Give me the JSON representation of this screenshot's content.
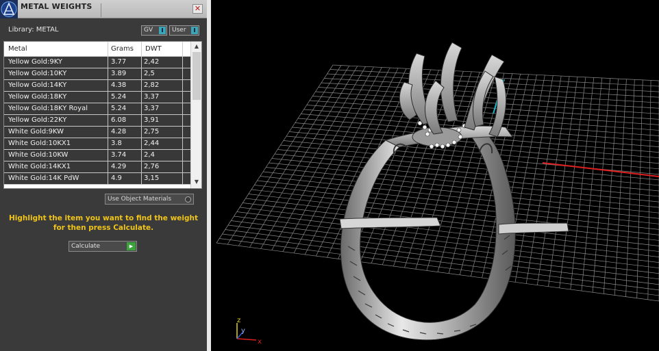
{
  "window": {
    "title": "METAL WEIGHTS",
    "close_glyph": "✕"
  },
  "library": {
    "label": "Library: METAL",
    "toggles": [
      {
        "label": "GV",
        "knob": "I"
      },
      {
        "label": "User",
        "knob": "I"
      }
    ]
  },
  "table": {
    "columns": [
      "Metal",
      "Grams",
      "DWT"
    ],
    "rows": [
      {
        "metal": "Yellow Gold:9KY",
        "grams": "3.77",
        "dwt": "2,42"
      },
      {
        "metal": "Yellow Gold:10KY",
        "grams": "3.89",
        "dwt": "2,5"
      },
      {
        "metal": "Yellow Gold:14KY",
        "grams": "4.38",
        "dwt": "2,82"
      },
      {
        "metal": "Yellow Gold:18KY",
        "grams": "5.24",
        "dwt": "3,37"
      },
      {
        "metal": "Yellow Gold:18KY Royal",
        "grams": "5.24",
        "dwt": "3,37"
      },
      {
        "metal": "Yellow Gold:22KY",
        "grams": "6.08",
        "dwt": "3,91"
      },
      {
        "metal": "White Gold:9KW",
        "grams": "4.28",
        "dwt": "2,75"
      },
      {
        "metal": "White Gold:10KX1",
        "grams": "3.8",
        "dwt": "2,44"
      },
      {
        "metal": "White Gold:10KW",
        "grams": "3.74",
        "dwt": "2,4"
      },
      {
        "metal": "White Gold:14KX1",
        "grams": "4.29",
        "dwt": "2,76"
      },
      {
        "metal": "White Gold:14K PdW",
        "grams": "4.9",
        "dwt": "3,15"
      }
    ],
    "scroll_up_glyph": "▲",
    "scroll_down_glyph": "▼"
  },
  "options": {
    "use_object_materials": "Use Object Materials"
  },
  "instructions": {
    "line1": "Highlight the item you want to find the weight",
    "line2": "for then press Calculate."
  },
  "actions": {
    "calculate_label": "Calculate",
    "calculate_glyph": "▶"
  },
  "viewport": {
    "axis_labels": {
      "z": "z",
      "y": "y",
      "x": "x"
    }
  },
  "colors": {
    "accent_yellow": "#f0c419",
    "axis_red": "#e02020",
    "axis_cyan": "#18b6c8",
    "axis_blue": "#2a5bd8",
    "axis_yellow": "#e8d020"
  },
  "icons": {
    "logo": "app-logo-icon",
    "close": "close-icon",
    "scroll_up": "chevron-up-icon",
    "scroll_down": "chevron-down-icon",
    "play": "play-icon",
    "radio": "radio-icon"
  }
}
